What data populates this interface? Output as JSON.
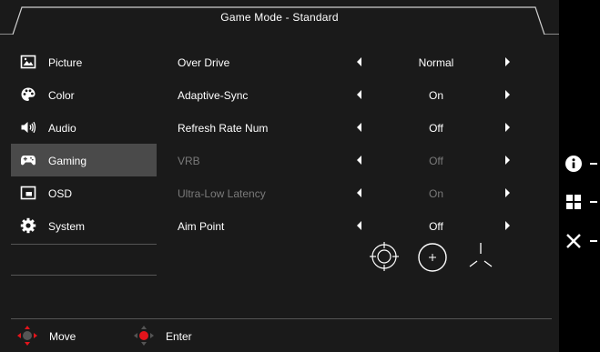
{
  "title": "Game Mode - Standard",
  "sidebar": {
    "items": [
      {
        "label": "Picture",
        "icon": "picture-icon",
        "active": false
      },
      {
        "label": "Color",
        "icon": "palette-icon",
        "active": false
      },
      {
        "label": "Audio",
        "icon": "speaker-icon",
        "active": false
      },
      {
        "label": "Gaming",
        "icon": "gamepad-icon",
        "active": true
      },
      {
        "label": "OSD",
        "icon": "osd-icon",
        "active": false
      },
      {
        "label": "System",
        "icon": "gear-icon",
        "active": false
      }
    ]
  },
  "settings": [
    {
      "name": "Over Drive",
      "value": "Normal",
      "enabled": true
    },
    {
      "name": "Adaptive-Sync",
      "value": "On",
      "enabled": true
    },
    {
      "name": "Refresh Rate Num",
      "value": "Off",
      "enabled": true
    },
    {
      "name": "VRB",
      "value": "Off",
      "enabled": false
    },
    {
      "name": "Ultra-Low Latency",
      "value": "On",
      "enabled": false
    },
    {
      "name": "Aim Point",
      "value": "Off",
      "enabled": true
    }
  ],
  "aim_point_options": [
    "crosshair-circle-icon",
    "crosshair-dot-icon",
    "crosshair-tri-icon"
  ],
  "footer": {
    "move_label": "Move",
    "enter_label": "Enter"
  },
  "right_panel": {
    "items": [
      "info-icon",
      "menu-grid-icon",
      "close-icon"
    ]
  },
  "colors": {
    "background": "#1a1a1a",
    "active_item": "#4a4a4a",
    "disabled_text": "#7a7a7a",
    "accent_red": "#e3141b"
  }
}
